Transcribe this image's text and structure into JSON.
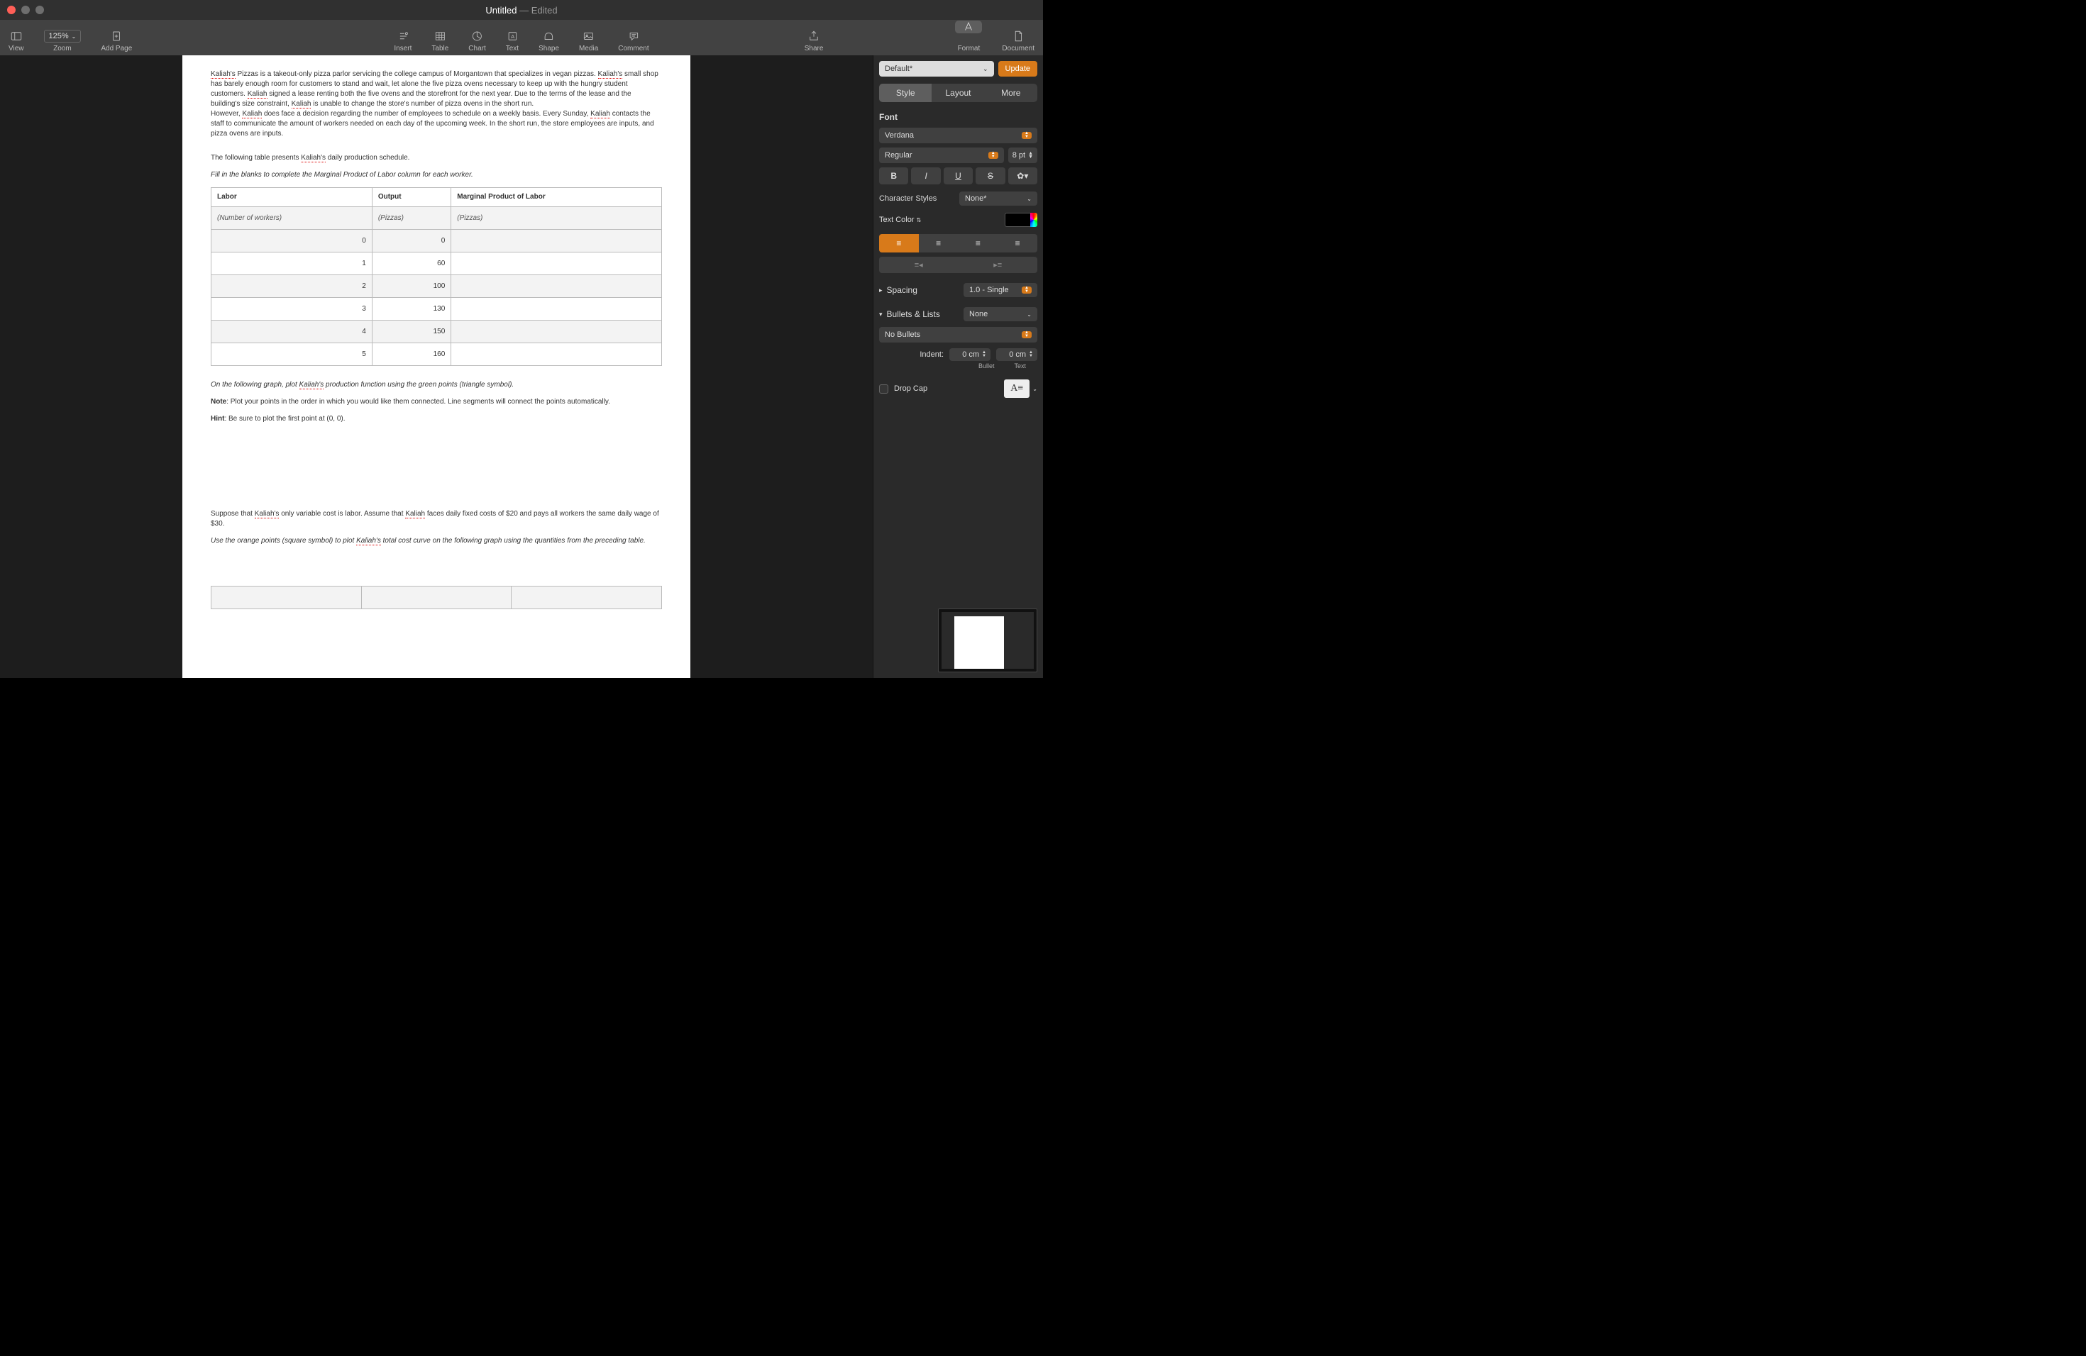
{
  "window": {
    "title": "Untitled",
    "edited": " — Edited"
  },
  "toolbar": {
    "view": "View",
    "zoom": "Zoom",
    "zoom_val": "125%",
    "addpage": "Add Page",
    "insert": "Insert",
    "table": "Table",
    "chart": "Chart",
    "text": "Text",
    "shape": "Shape",
    "media": "Media",
    "comment": "Comment",
    "share": "Share",
    "format": "Format",
    "document": "Document"
  },
  "doc": {
    "p1a": "Kaliah's",
    "p1b": " Pizzas is a takeout-only pizza parlor servicing the college campus of Morgantown that specializes in vegan pizzas. ",
    "p1c": "Kaliah's",
    "p1d": " small shop has barely enough room for customers to stand and wait, let alone the five pizza ovens necessary to keep up with the hungry student customers. ",
    "p1e": "Kaliah",
    "p1f": " signed a lease renting both the five ovens and the storefront for the next year. Due to the terms of the lease and the building's size constraint, ",
    "p1g": "Kaliah",
    "p1h": " is unable to change the store's number of pizza ovens in the short run.",
    "p2a": "However, ",
    "p2b": "Kaliah",
    "p2c": " does face a decision regarding the number of employees to schedule on a weekly basis. Every Sunday, ",
    "p2d": "Kaliah",
    "p2e": " contacts the staff to communicate the amount of workers needed on each day of the upcoming week. In the short run, the store employees are     inputs, and pizza ovens are     inputs.",
    "p3a": "The following table presents ",
    "p3b": "Kaliah's",
    "p3c": " daily production schedule.",
    "p4": "Fill in the blanks to complete the Marginal Product of Labor column for each worker.",
    "table": {
      "h1": "Labor",
      "h2": "Output",
      "h3": "Marginal Product of Labor",
      "sub1": "(Number of workers)",
      "sub2": "(Pizzas)",
      "sub3": "(Pizzas)",
      "rows": [
        {
          "labor": "0",
          "output": "0",
          "mpl": ""
        },
        {
          "labor": "1",
          "output": "60",
          "mpl": ""
        },
        {
          "labor": "2",
          "output": "100",
          "mpl": ""
        },
        {
          "labor": "3",
          "output": "130",
          "mpl": ""
        },
        {
          "labor": "4",
          "output": "150",
          "mpl": ""
        },
        {
          "labor": "5",
          "output": "160",
          "mpl": ""
        }
      ]
    },
    "p5a": "On the following graph, plot ",
    "p5b": "Kaliah's",
    "p5c": " production function using the green points (triangle symbol).",
    "p6a": "Note",
    "p6b": ": Plot your points in the order in which you would like them connected. Line segments will connect the points automatically.",
    "p7a": "Hint",
    "p7b": ": Be sure to plot the first point at (0, 0).",
    "p8a": "Suppose that ",
    "p8b": "Kaliah's",
    "p8c": " only variable cost is labor. Assume that ",
    "p8d": "Kaliah",
    "p8e": " faces daily fixed costs of $20 and pays all workers the same daily wage of $30.",
    "p9a": "Use the orange points (square symbol) to plot ",
    "p9b": "Kaliah's",
    "p9c": " total cost curve on the following graph using the quantities from the preceding table."
  },
  "inspector": {
    "para_style": "Default*",
    "update": "Update",
    "tab_style": "Style",
    "tab_layout": "Layout",
    "tab_more": "More",
    "font_hdr": "Font",
    "font_family": "Verdana",
    "font_weight": "Regular",
    "font_size": "8 pt",
    "b": "B",
    "i": "I",
    "u": "U",
    "s": "S",
    "char_styles": "Character Styles",
    "char_styles_val": "None*",
    "text_color": "Text Color",
    "spacing": "Spacing",
    "spacing_val": "1.0 - Single",
    "bullets": "Bullets & Lists",
    "bullets_val": "None",
    "no_bullets": "No Bullets",
    "indent": "Indent:",
    "indent_bullet": "0 cm",
    "indent_text": "0 cm",
    "lbl_bullet": "Bullet",
    "lbl_text": "Text",
    "dropcap": "Drop Cap"
  }
}
